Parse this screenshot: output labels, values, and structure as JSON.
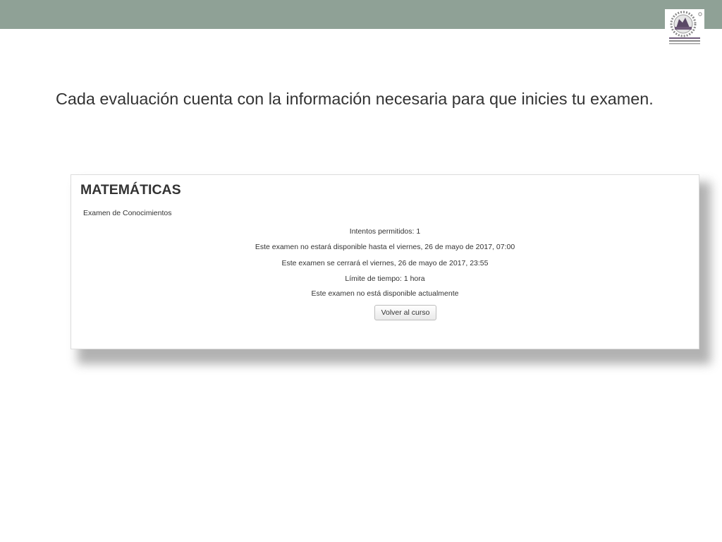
{
  "slide": {
    "caption": "Cada evaluación cuenta con la información necesaria para que inicies tu examen.",
    "header_color": "#8fa196",
    "logo_icon": "institution-seal-icon"
  },
  "screenshot": {
    "course_title": "MATEMÁTICAS",
    "quiz_name": "Examen de Conocimientos",
    "info": {
      "attempts": "Intentos permitidos: 1",
      "opens": "Este examen no estará disponible hasta el viernes, 26 de mayo de 2017, 07:00",
      "closes": "Este examen se cerrará el viernes, 26 de mayo de 2017, 23:55",
      "time_limit": "Límite de tiempo: 1 hora",
      "availability": "Este examen no está disponible actualmente"
    },
    "back_button_label": "Volver al curso"
  }
}
